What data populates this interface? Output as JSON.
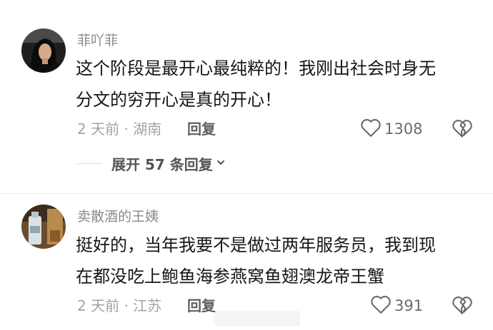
{
  "comments": [
    {
      "username": "菲吖菲",
      "text_line1": "这个阶段是最开心最纯粹的！我刚出社会时身无",
      "text_line2": "分文的穷开心是真的开心！",
      "time_location": "2 天前 · 湖南",
      "reply_label": "回复",
      "like_count": "1308",
      "expand_label": "展开 57 条回复"
    },
    {
      "username": "卖散酒的王姨",
      "text_line1": "挺好的，当年我要不是做过两年服务员，我到现",
      "text_line2": "在都没吃上鲍鱼海参燕窝鱼翅澳龙帝王蟹",
      "time_location": "2 天前 · 江苏",
      "reply_label": "回复",
      "like_count": "391"
    }
  ],
  "icons": {
    "like": "heart-outline-icon",
    "dislike": "broken-heart-icon",
    "expand": "chevron-down-icon"
  },
  "colors": {
    "username": "#8a8a8a",
    "content": "#161616",
    "meta": "#a3a3a3",
    "reply": "#5f5f5f"
  }
}
